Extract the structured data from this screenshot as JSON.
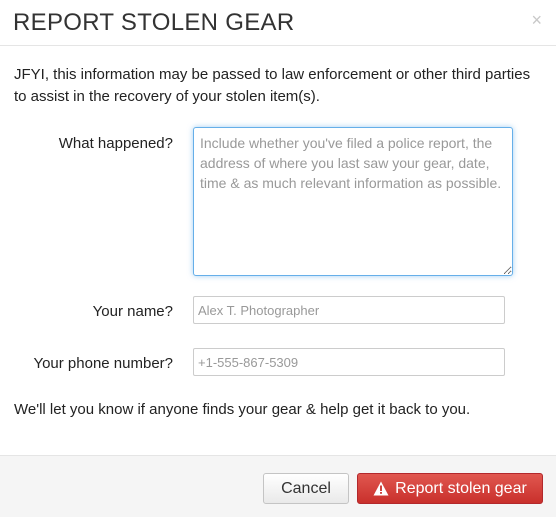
{
  "dialog": {
    "title": "REPORT STOLEN GEAR",
    "close_label": "×",
    "close_icon": "close-icon"
  },
  "intro_text": "JFYI, this information may be passed to law enforcement or other third parties to assist in the recovery of your stolen item(s).",
  "form": {
    "what_happened": {
      "label": "What happened?",
      "placeholder": "Include whether you've filed a police report, the address of where you last saw your gear, date, time & as much relevant information as possible.",
      "value": ""
    },
    "your_name": {
      "label": "Your name?",
      "placeholder": "Alex T. Photographer",
      "value": ""
    },
    "phone": {
      "label": "Your phone number?",
      "placeholder": "+1-555-867-5309",
      "value": ""
    }
  },
  "note_text": "We'll let you know if anyone finds your gear & help get it back to you.",
  "footer": {
    "cancel_label": "Cancel",
    "report_label": "Report stolen gear",
    "report_icon": "warning-icon"
  },
  "colors": {
    "accent_danger": "#d9534f",
    "focus_border": "#66afe9"
  }
}
